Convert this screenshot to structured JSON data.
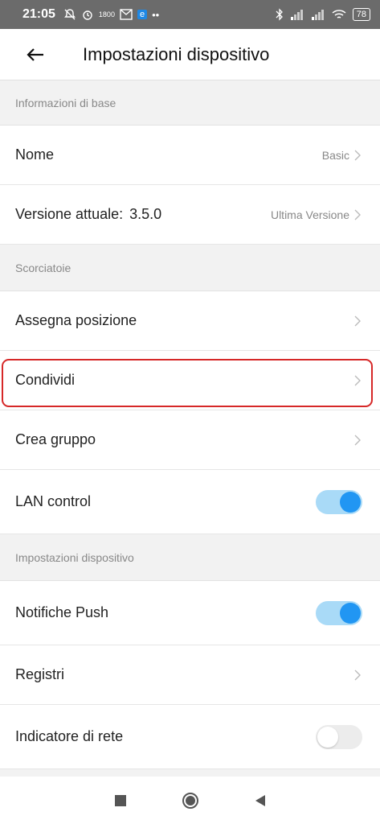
{
  "status_bar": {
    "time": "21:05",
    "speed": "1800",
    "battery": "78"
  },
  "header": {
    "title": "Impostazioni dispositivo"
  },
  "sections": {
    "basic": {
      "header": "Informazioni di base",
      "name_label": "Nome",
      "name_value": "Basic",
      "version_label": "Versione attuale:",
      "version_number": "3.5.0",
      "version_value": "Ultima Versione"
    },
    "shortcuts": {
      "header": "Scorciatoie",
      "assign_label": "Assegna posizione",
      "share_label": "Condividi",
      "group_label": "Crea gruppo",
      "lan_label": "LAN control",
      "lan_on": true
    },
    "device": {
      "header": "Impostazioni dispositivo",
      "push_label": "Notifiche Push",
      "push_on": true,
      "logs_label": "Registri",
      "network_label": "Indicatore di rete",
      "network_on": false
    }
  },
  "colors": {
    "accent": "#2196f3",
    "toggle_track_on": "#a9daf7",
    "highlight": "#d62828"
  }
}
